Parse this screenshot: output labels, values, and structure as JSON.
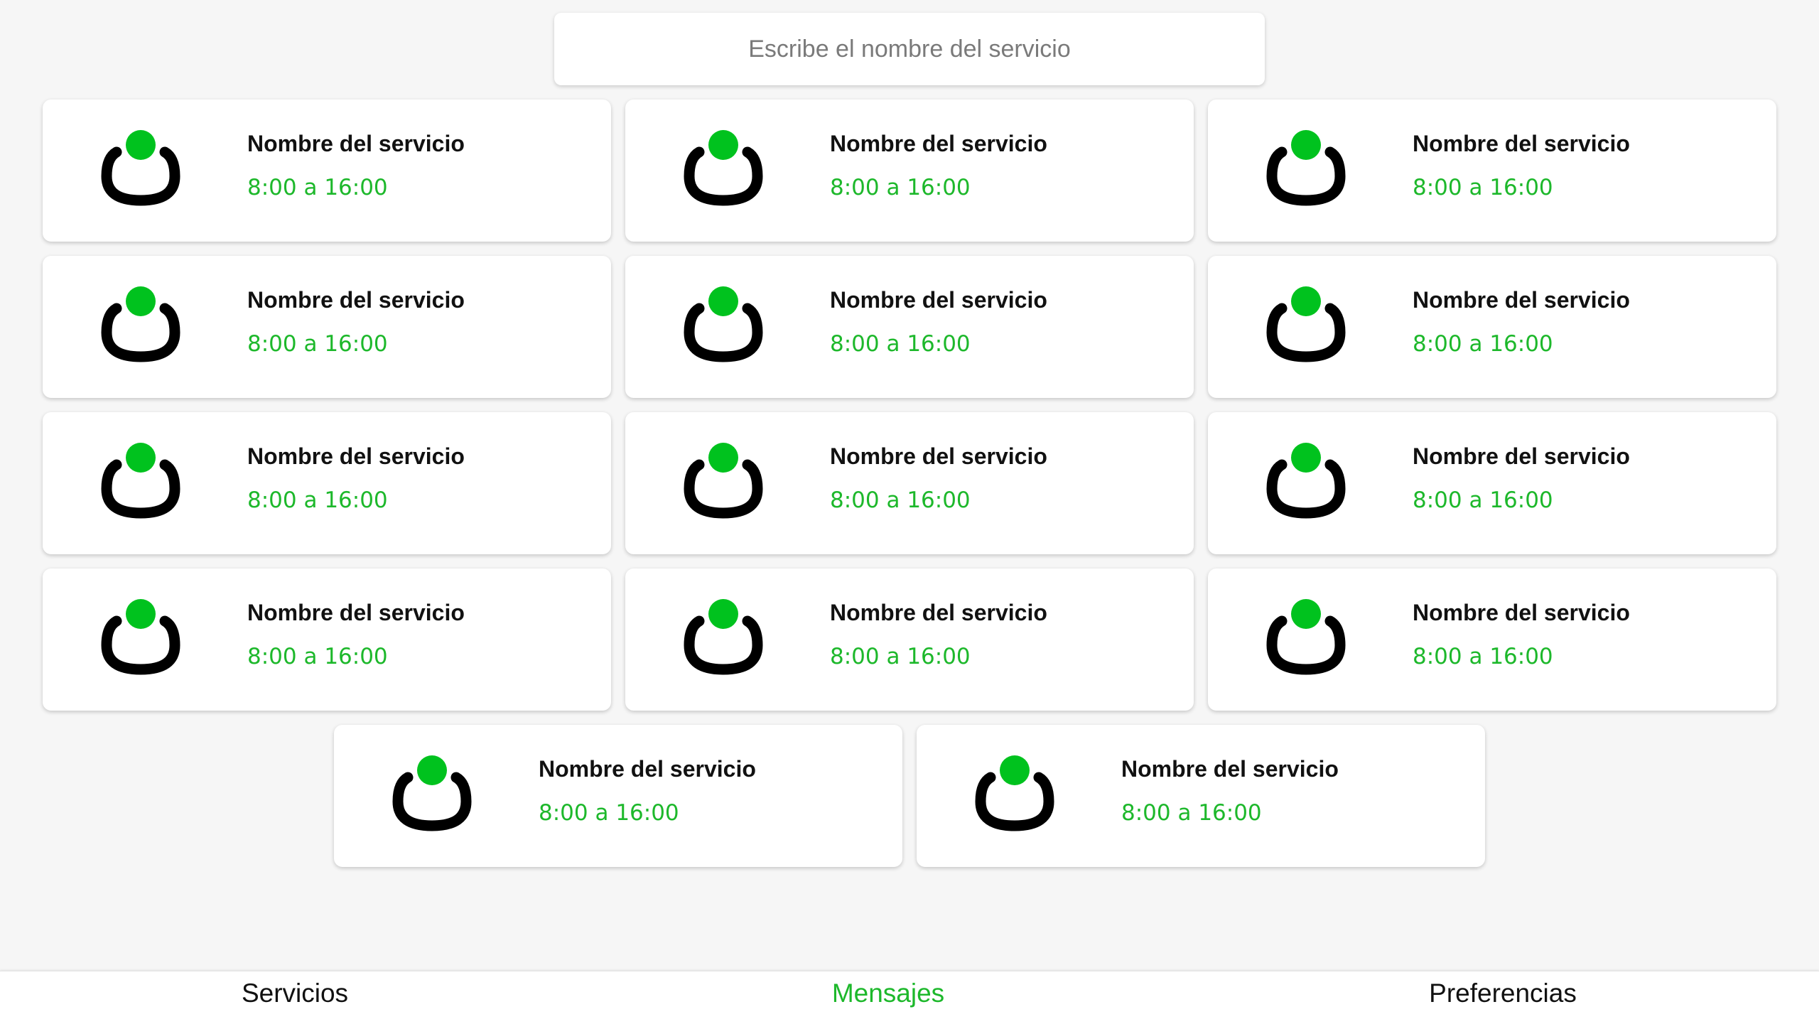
{
  "search": {
    "placeholder": "Escribe el nombre del servicio",
    "value": ""
  },
  "colors": {
    "accent": "#1db82b",
    "icon_ring": "#000000",
    "icon_dot": "#00c21e",
    "background": "#f6f6f6",
    "card": "#ffffff"
  },
  "services": [
    {
      "name": "Nombre del servicio",
      "hours": "8:00 a 16:00",
      "icon": "service-logo-icon"
    },
    {
      "name": "Nombre del servicio",
      "hours": "8:00 a 16:00",
      "icon": "service-logo-icon"
    },
    {
      "name": "Nombre del servicio",
      "hours": "8:00 a 16:00",
      "icon": "service-logo-icon"
    },
    {
      "name": "Nombre del servicio",
      "hours": "8:00 a 16:00",
      "icon": "service-logo-icon"
    },
    {
      "name": "Nombre del servicio",
      "hours": "8:00 a 16:00",
      "icon": "service-logo-icon"
    },
    {
      "name": "Nombre del servicio",
      "hours": "8:00 a 16:00",
      "icon": "service-logo-icon"
    },
    {
      "name": "Nombre del servicio",
      "hours": "8:00 a 16:00",
      "icon": "service-logo-icon"
    },
    {
      "name": "Nombre del servicio",
      "hours": "8:00 a 16:00",
      "icon": "service-logo-icon"
    },
    {
      "name": "Nombre del servicio",
      "hours": "8:00 a 16:00",
      "icon": "service-logo-icon"
    },
    {
      "name": "Nombre del servicio",
      "hours": "8:00 a 16:00",
      "icon": "service-logo-icon"
    },
    {
      "name": "Nombre del servicio",
      "hours": "8:00 a 16:00",
      "icon": "service-logo-icon"
    },
    {
      "name": "Nombre del servicio",
      "hours": "8:00 a 16:00",
      "icon": "service-logo-icon"
    },
    {
      "name": "Nombre del servicio",
      "hours": "8:00 a 16:00",
      "icon": "service-logo-icon"
    },
    {
      "name": "Nombre del servicio",
      "hours": "8:00 a 16:00",
      "icon": "service-logo-icon"
    }
  ],
  "nav": {
    "items": [
      {
        "label": "Servicios",
        "active": false
      },
      {
        "label": "Mensajes",
        "active": true
      },
      {
        "label": "Preferencias",
        "active": false
      }
    ]
  }
}
